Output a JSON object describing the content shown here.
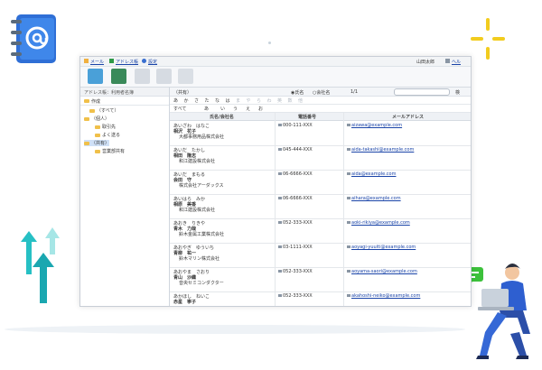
{
  "topbar": {
    "mail": "メール",
    "addressbook": "アドレス帳",
    "settings": "設定",
    "user": "山田太郎",
    "help": "ヘル"
  },
  "sidebar": {
    "header": "アドレス帳：利用者名簿",
    "create": "作成",
    "tree": [
      {
        "label": "（すべて）",
        "indent": 1
      },
      {
        "label": "（個人）",
        "indent": 0
      },
      {
        "label": "取引先",
        "indent": 2
      },
      {
        "label": "よく送る",
        "indent": 2
      },
      {
        "label": "（共有）",
        "indent": 0
      },
      {
        "label": "営業部共有",
        "indent": 2
      }
    ]
  },
  "main": {
    "folder": "（共有）",
    "radio_name": "氏名",
    "radio_company": "会社名",
    "page": "1/1",
    "search_button": "検",
    "kana_top": [
      "あ",
      "か",
      "さ",
      "た",
      "な",
      "は",
      "ま",
      "や",
      "ら",
      "わ",
      "英",
      "数",
      "他"
    ],
    "kana_sub": [
      "すべて",
      "あ",
      "い",
      "う",
      "え",
      "お"
    ],
    "columns": [
      "氏名/会社名",
      "電話番号",
      "メールアドレス"
    ],
    "rows": [
      {
        "kana": "あいざわ　はなこ",
        "name": "相沢　花子",
        "company": "大都事務用品株式会社",
        "phone": "000-111-XXX",
        "email": "aizawa@example.com"
      },
      {
        "kana": "あいだ　たかし",
        "name": "相田　隆志",
        "company": "和江建設株式会社",
        "phone": "045-444-XXX",
        "email": "aida-takashi@example.com"
      },
      {
        "kana": "あいだ　まもる",
        "name": "会田　守",
        "company": "株式会社アーダックス",
        "phone": "06-6666-XXX",
        "email": "aida@example.com"
      },
      {
        "kana": "あいはら　みか",
        "name": "相原　美香",
        "company": "和江建設株式会社",
        "phone": "06-6666-XXX",
        "email": "aihara@example.com"
      },
      {
        "kana": "あおき　りきや",
        "name": "青木　力哉",
        "company": "鈴木金属工業株式会社",
        "phone": "052-333-XXX",
        "email": "aoki-rikiya@example.com"
      },
      {
        "kana": "あおやぎ　ゆういち",
        "name": "青柳　祐一",
        "company": "鈴木マリン株式会社",
        "phone": "03-1111-XXX",
        "email": "aoyagi-yuuiti@example.com"
      },
      {
        "kana": "あおやま　さおり",
        "name": "青山　沙織",
        "company": "音央セミコンダクター",
        "phone": "052-333-XXX",
        "email": "aoyama-saori@example.com"
      },
      {
        "kana": "あかほし　ねいこ",
        "name": "赤星　寧子",
        "company": "",
        "phone": "052-333-XXX",
        "email": "akahoshi-neiko@example.com"
      }
    ]
  },
  "colors": {
    "accent": "#1a44a8",
    "illustration_blue": "#2e5fd0",
    "teal": "#1fb8b8",
    "yellow": "#f2cc1e",
    "green_bubble": "#3cc13b"
  },
  "icons": [
    "address-book-icon",
    "sparkle-icon",
    "up-arrows-icon",
    "person-laptop-icon",
    "speech-bubble-icon"
  ]
}
